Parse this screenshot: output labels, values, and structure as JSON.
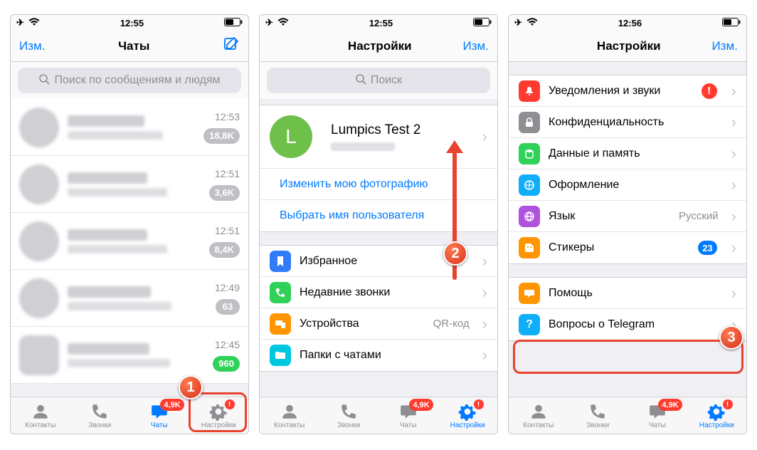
{
  "status": {
    "time1": "12:55",
    "time2": "12:55",
    "time3": "12:56"
  },
  "nav": {
    "edit": "Изм.",
    "chats_title": "Чаты",
    "settings_title": "Настройки"
  },
  "search": {
    "chats_placeholder": "Поиск по сообщениям и людям",
    "settings_placeholder": "Поиск"
  },
  "chats": [
    {
      "time": "12:53",
      "badge": "18,8K"
    },
    {
      "time": "12:51",
      "badge": "3,6K"
    },
    {
      "time": "12:51",
      "badge": "8,4K"
    },
    {
      "time": "12:49",
      "badge": "63"
    },
    {
      "time": "12:45",
      "badge": "960"
    }
  ],
  "profile": {
    "initial": "L",
    "name": "Lumpics Test 2"
  },
  "links": {
    "change_photo": "Изменить мою фотографию",
    "choose_username": "Выбрать имя пользователя"
  },
  "sg1": {
    "fav": "Избранное",
    "recent": "Недавние звонки",
    "devices": "Устройства",
    "devices_detail": "QR-код",
    "folders": "Папки с чатами"
  },
  "sg2": {
    "notif": "Уведомления и звуки",
    "priv": "Конфиденциальность",
    "data": "Данные и память",
    "appearance": "Оформление",
    "lang": "Язык",
    "lang_val": "Русский",
    "stickers": "Стикеры",
    "stickers_badge": "23"
  },
  "sg3": {
    "help": "Помощь",
    "faq": "Вопросы о Telegram"
  },
  "tabs": {
    "contacts": "Контакты",
    "calls": "Звонки",
    "chats": "Чаты",
    "settings": "Настройки",
    "chats_badge": "4,9K"
  },
  "steps": {
    "s1": "1",
    "s2": "2",
    "s3": "3"
  }
}
